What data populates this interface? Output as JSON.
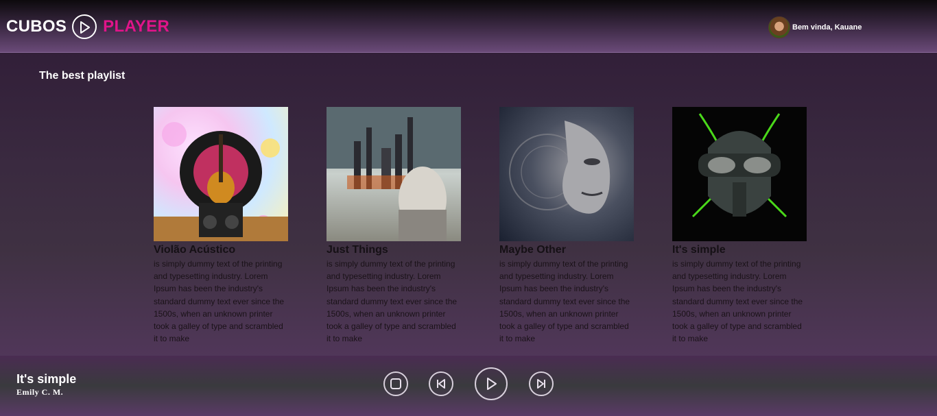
{
  "header": {
    "logo_left": "CUBOS",
    "logo_right": "PLAYER",
    "greeting": "Bem vinda, Kauane"
  },
  "section": {
    "title": "The best playlist"
  },
  "playlists": [
    {
      "title": "Violão Acústico",
      "description": "is simply dummy text of the printing and typesetting industry. Lorem Ipsum has been the industry's standard dummy text ever since the 1500s, when an unknown printer took a galley of type and scrambled it to make"
    },
    {
      "title": "Just Things",
      "description": "is simply dummy text of the printing and typesetting industry. Lorem Ipsum has been the industry's standard dummy text ever since the 1500s, when an unknown printer took a galley of type and scrambled it to make"
    },
    {
      "title": "Maybe Other",
      "description": "is simply dummy text of the printing and typesetting industry. Lorem Ipsum has been the industry's standard dummy text ever since the 1500s, when an unknown printer took a galley of type and scrambled it to make"
    },
    {
      "title": "It's simple",
      "description": "is simply dummy text of the printing and typesetting industry. Lorem Ipsum has been the industry's standard dummy text ever since the 1500s, when an unknown printer took a galley of type and scrambled it to make"
    }
  ],
  "player": {
    "title": "It's simple",
    "artist": "Emily C. M.",
    "controls": [
      "stop-icon",
      "previous-icon",
      "play-icon",
      "next-icon"
    ]
  },
  "colors": {
    "brand_accent": "#e0148a",
    "header_bg": "#3a2842",
    "body_bg": "#2e1a35"
  }
}
